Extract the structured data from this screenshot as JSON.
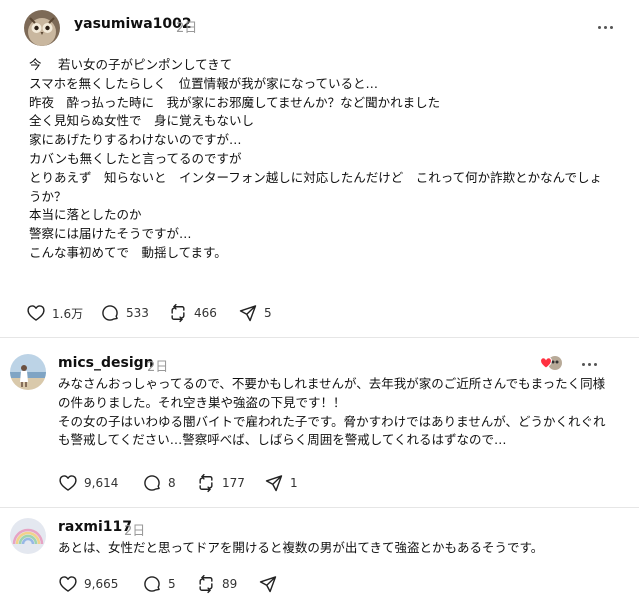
{
  "posts": [
    {
      "username": "yasumiwa1002",
      "time": "2日",
      "lines": [
        "今　 若い女の子がピンポンしてきて",
        "スマホを無くしたらしく　位置情報が我が家になっていると…",
        "昨夜　酔っ払った時に　我が家にお邪魔してませんか？など聞かれました",
        "全く見知らぬ女性で　身に覚えもないし",
        "家にあげたりするわけないのですが…",
        "カバンも無くしたと言ってるのですが",
        "とりあえず　知らないと　インターフォン越しに対応したんだけど　これって何か詐欺とかなんでしょ",
        "うか？",
        "本当に落としたのか",
        "警察には届けたそうですが…",
        "こんな事初めてで　動揺してます。"
      ],
      "likes": "1.6万",
      "replies": "533",
      "reposts": "466",
      "shares": "5"
    },
    {
      "username": "mics_design",
      "time": "2日",
      "lines": [
        "みなさんおっしゃってるので、不要かもしれませんが、去年我が家のご近所さんでもまったく同様",
        "の件ありました。それ空き巣や強盗の下見です！！",
        "その女の子はいわゆる闇バイトで雇われた子です。脅かすわけではありませんが、どうかくれぐれ",
        "も警戒してください…警察呼べば、しばらく周囲を警戒してくれるはずなので…"
      ],
      "likes": "9,614",
      "replies": "8",
      "reposts": "177",
      "shares": "1"
    },
    {
      "username": "raxmi117",
      "time": "2日",
      "lines": [
        "あとは、女性だと思ってドアを開けると複数の男が出てきて強盗とかもあるそうです。"
      ],
      "likes": "9,665",
      "replies": "5",
      "reposts": "89",
      "shares": ""
    }
  ],
  "icons": {
    "like": "heart-icon",
    "reply": "comment-icon",
    "repost": "repost-icon",
    "share": "send-icon",
    "more": "more-icon",
    "liked_by_author": "liked-by-author-icon"
  },
  "colors": {
    "text": "#101010",
    "muted": "#999999",
    "divider": "#e6e6e6",
    "heart_red": "#ff3040"
  }
}
